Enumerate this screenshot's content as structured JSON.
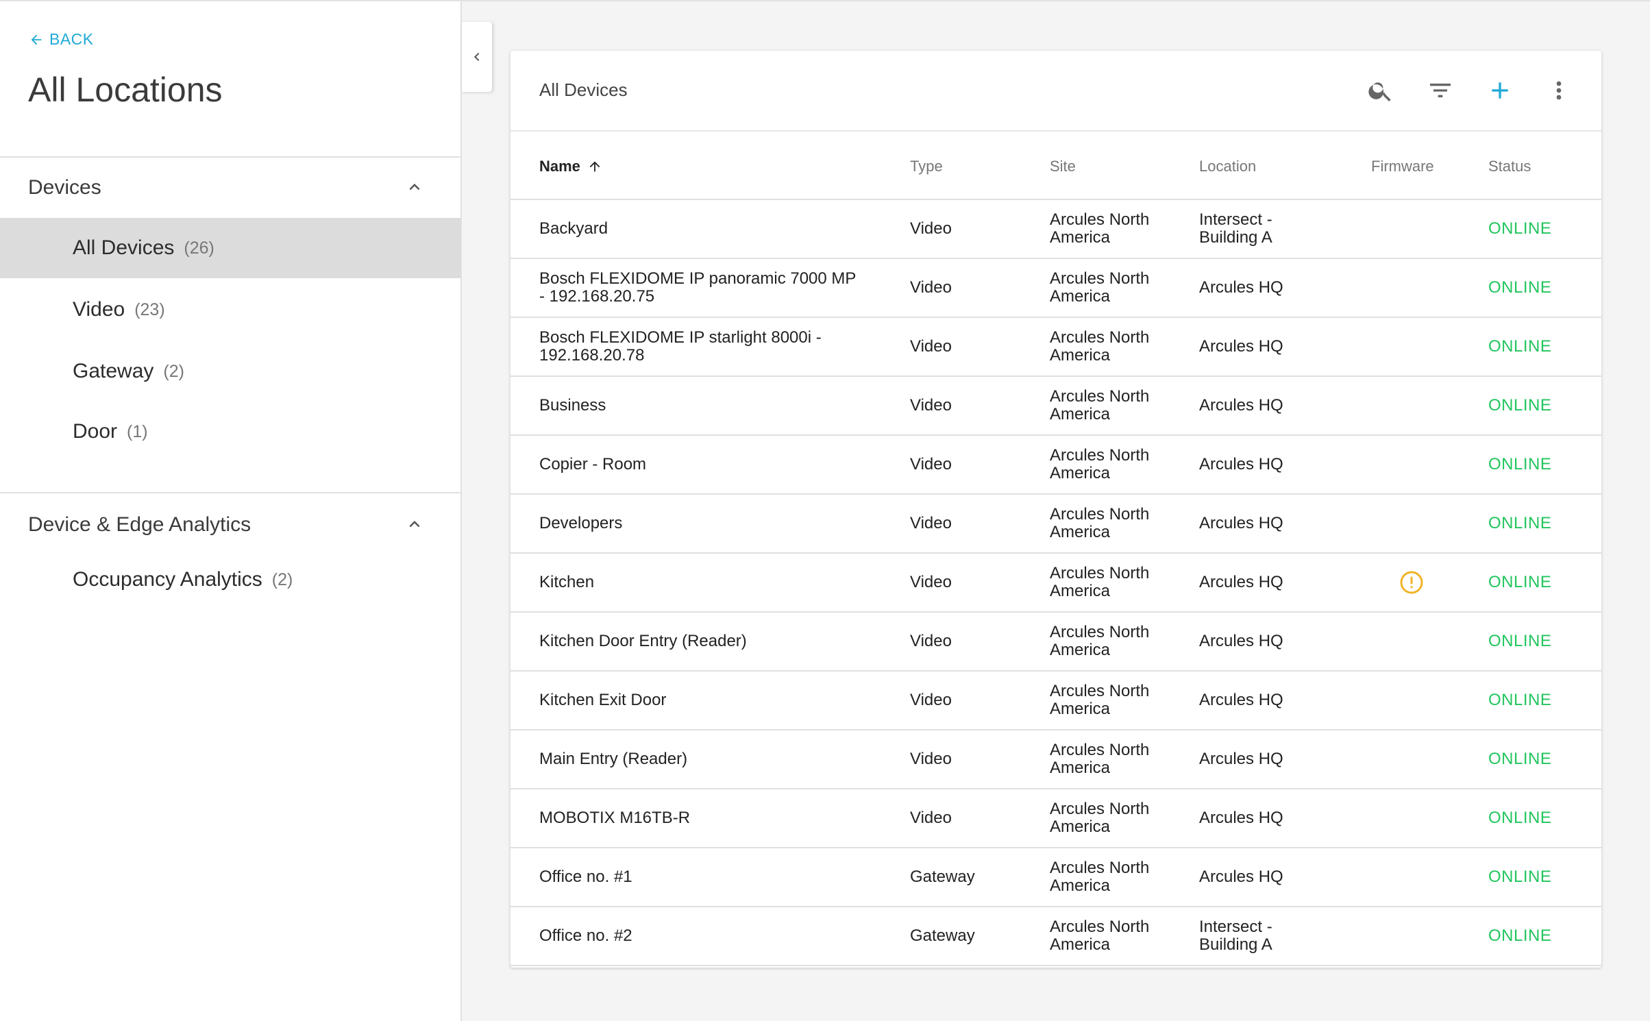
{
  "sidebar": {
    "back_label": "BACK",
    "title": "All Locations",
    "sections": [
      {
        "label": "Devices",
        "items": [
          {
            "label": "All Devices",
            "count": "(26)"
          },
          {
            "label": "Video",
            "count": "(23)"
          },
          {
            "label": "Gateway",
            "count": "(2)"
          },
          {
            "label": "Door",
            "count": "(1)"
          }
        ]
      },
      {
        "label": "Device & Edge Analytics",
        "items": [
          {
            "label": "Occupancy Analytics",
            "count": "(2)"
          }
        ]
      }
    ]
  },
  "card": {
    "title": "All Devices",
    "columns": {
      "name": "Name",
      "type": "Type",
      "site": "Site",
      "location": "Location",
      "firmware": "Firmware",
      "status": "Status"
    },
    "rows": [
      {
        "name": "Backyard",
        "type": "Video",
        "site": "Arcules North America",
        "location": "Intersect - Building A",
        "status": "ONLINE"
      },
      {
        "name": "Bosch FLEXIDOME IP panoramic 7000 MP - 192.168.20.75",
        "type": "Video",
        "site": "Arcules North America",
        "location": "Arcules HQ",
        "status": "ONLINE"
      },
      {
        "name": "Bosch FLEXIDOME IP starlight 8000i - 192.168.20.78",
        "type": "Video",
        "site": "Arcules North America",
        "location": "Arcules HQ",
        "status": "ONLINE"
      },
      {
        "name": "Business",
        "type": "Video",
        "site": "Arcules North America",
        "location": "Arcules HQ",
        "status": "ONLINE"
      },
      {
        "name": "Copier - Room",
        "type": "Video",
        "site": "Arcules North America",
        "location": "Arcules HQ",
        "status": "ONLINE"
      },
      {
        "name": "Developers",
        "type": "Video",
        "site": "Arcules North America",
        "location": "Arcules HQ",
        "status": "ONLINE"
      },
      {
        "name": "Kitchen",
        "type": "Video",
        "site": "Arcules North America",
        "location": "Arcules HQ",
        "status": "ONLINE"
      },
      {
        "name": "Kitchen Door Entry (Reader)",
        "type": "Video",
        "site": "Arcules North America",
        "location": "Arcules HQ",
        "status": "ONLINE"
      },
      {
        "name": "Kitchen Exit Door",
        "type": "Video",
        "site": "Arcules North America",
        "location": "Arcules HQ",
        "status": "ONLINE"
      },
      {
        "name": "Main Entry (Reader)",
        "type": "Video",
        "site": "Arcules North America",
        "location": "Arcules HQ",
        "status": "ONLINE"
      },
      {
        "name": "MOBOTIX M16TB-R",
        "type": "Video",
        "site": "Arcules North America",
        "location": "Arcules HQ",
        "status": "ONLINE"
      },
      {
        "name": "Office no. #1",
        "type": "Gateway",
        "site": "Arcules North America",
        "location": "Arcules HQ",
        "status": "ONLINE"
      },
      {
        "name": "Office no. #2",
        "type": "Gateway",
        "site": "Arcules North America",
        "location": "Intersect - Building A",
        "status": "ONLINE"
      }
    ]
  },
  "colors": {
    "accent": "#1fa9d6",
    "online": "#22c55e",
    "warning": "#f0b429",
    "active_row": "#dcdcdc"
  },
  "icons": [
    "arrow-left-icon",
    "chevron-up-icon",
    "chevron-left-icon",
    "search-icon",
    "filter-icon",
    "add-icon",
    "more-vert-icon",
    "arrow-up-icon",
    "warning-icon"
  ]
}
